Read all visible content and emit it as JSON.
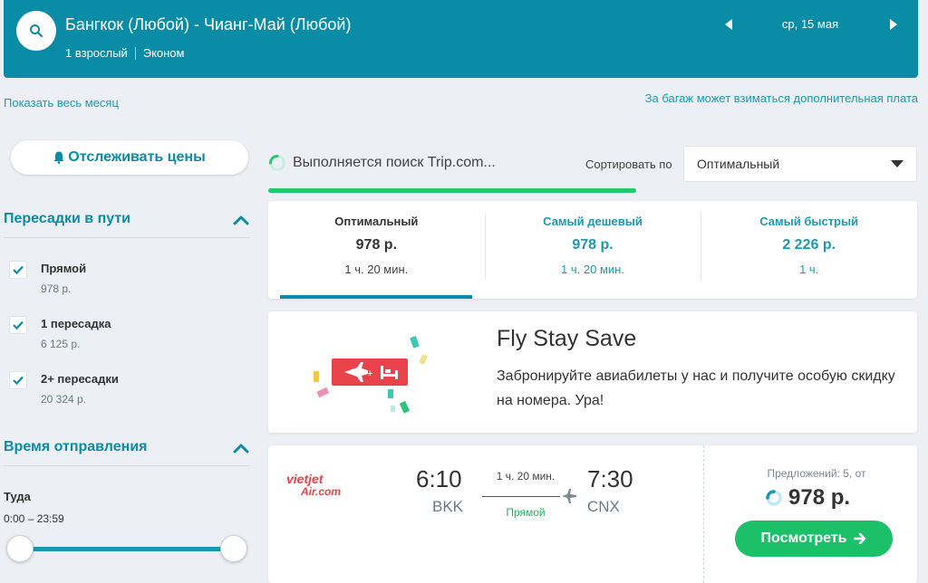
{
  "header": {
    "route": "Бангкок (Любой) - Чианг-Май (Любой)",
    "passengers": "1 взрослый",
    "cabin": "Эконом",
    "date": "ср, 15 мая"
  },
  "links": {
    "show_month": "Показать весь месяц",
    "baggage_note": "За багаж может взиматься дополнительная плата"
  },
  "sidebar": {
    "track_prices": "Отслеживать цены",
    "stops_title": "Пересадки в пути",
    "stops": [
      {
        "label": "Прямой",
        "price": "978 р.",
        "checked": true
      },
      {
        "label": "1 пересадка",
        "price": "6 125 р.",
        "checked": true
      },
      {
        "label": "2+ пересадки",
        "price": "20 324 р.",
        "checked": true
      }
    ],
    "departure_title": "Время отправления",
    "direction_label": "Туда",
    "time_range": "0:00 – 23:59"
  },
  "main": {
    "search_status": "Выполняется поиск Trip.com...",
    "progress": 0.56,
    "sort_label": "Сортировать по",
    "sort_value": "Оптимальный",
    "tabs": [
      {
        "name": "Оптимальный",
        "price": "978 р.",
        "duration": "1 ч. 20 мин."
      },
      {
        "name": "Самый дешевый",
        "price": "978 р.",
        "duration": "1 ч. 20 мин."
      },
      {
        "name": "Самый быстрый",
        "price": "2 226 р.",
        "duration": "1 ч."
      }
    ],
    "promo": {
      "title": "Fly Stay Save",
      "text": "Забронируйте авиабилеты у нас и получите особую скидку на номера. Ура!"
    },
    "result": {
      "airline_logo_text": "vietjetAir.com",
      "dep_time": "6:10",
      "dep_code": "BKK",
      "arr_time": "7:30",
      "arr_code": "CNX",
      "duration": "1 ч. 20 мин.",
      "stops": "Прямой",
      "offers": "Предложений: 5, от",
      "price": "978 р.",
      "view_button": "Посмотреть"
    }
  },
  "colors": {
    "header_bg": "#0b8ca6",
    "accent_teal": "#1a9ab0",
    "green": "#1cc069",
    "promo_red": "#e8434a"
  }
}
